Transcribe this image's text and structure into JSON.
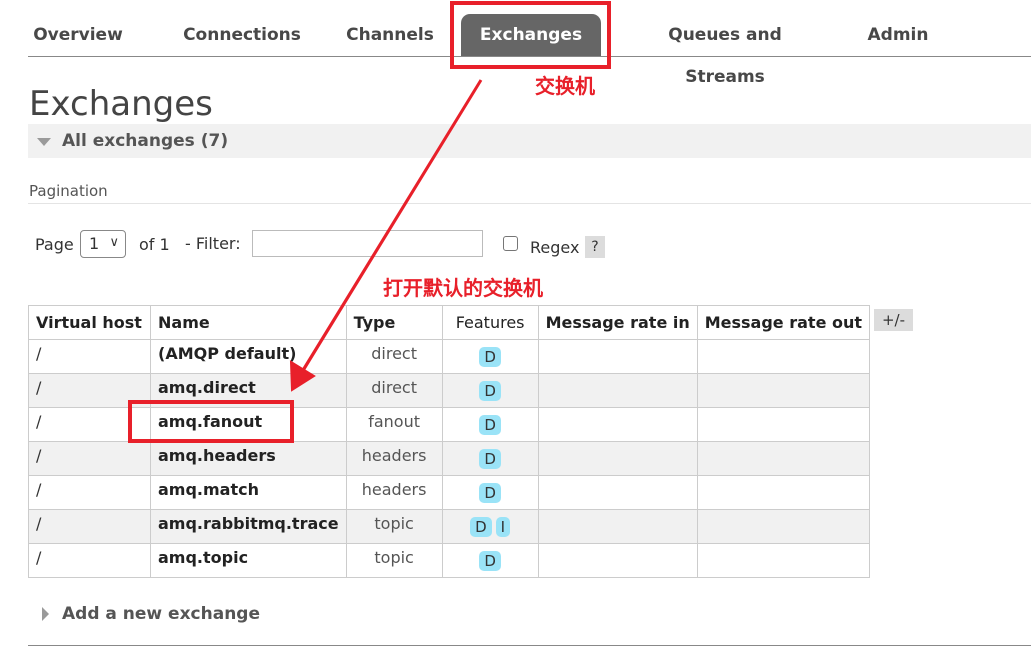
{
  "nav": {
    "tabs": [
      {
        "label": "Overview"
      },
      {
        "label": "Connections"
      },
      {
        "label": "Channels"
      },
      {
        "label": "Exchanges",
        "active": true
      },
      {
        "label": "Queues and Streams"
      },
      {
        "label": "Admin"
      }
    ]
  },
  "page": {
    "title": "Exchanges",
    "section_title": "All exchanges (7)"
  },
  "pagination": {
    "label": "Pagination",
    "page_label": "Page",
    "page_value": "1",
    "of_label": "of 1",
    "filter_label": "- Filter:",
    "filter_value": "",
    "regex_label": "Regex",
    "regex_checked": false,
    "help_label": "?"
  },
  "table": {
    "headers": [
      "Virtual host",
      "Name",
      "Type",
      "Features",
      "Message rate in",
      "Message rate out"
    ],
    "toggle_columns_label": "+/-",
    "rows": [
      {
        "vhost": "/",
        "name": "(AMQP default)",
        "type": "direct",
        "features": [
          "D"
        ],
        "rate_in": "",
        "rate_out": ""
      },
      {
        "vhost": "/",
        "name": "amq.direct",
        "type": "direct",
        "features": [
          "D"
        ],
        "rate_in": "",
        "rate_out": ""
      },
      {
        "vhost": "/",
        "name": "amq.fanout",
        "type": "fanout",
        "features": [
          "D"
        ],
        "rate_in": "",
        "rate_out": ""
      },
      {
        "vhost": "/",
        "name": "amq.headers",
        "type": "headers",
        "features": [
          "D"
        ],
        "rate_in": "",
        "rate_out": ""
      },
      {
        "vhost": "/",
        "name": "amq.match",
        "type": "headers",
        "features": [
          "D"
        ],
        "rate_in": "",
        "rate_out": ""
      },
      {
        "vhost": "/",
        "name": "amq.rabbitmq.trace",
        "type": "topic",
        "features": [
          "D",
          "I"
        ],
        "rate_in": "",
        "rate_out": ""
      },
      {
        "vhost": "/",
        "name": "amq.topic",
        "type": "topic",
        "features": [
          "D"
        ],
        "rate_in": "",
        "rate_out": ""
      }
    ]
  },
  "add_section": {
    "label": "Add a new exchange"
  },
  "annotations": {
    "tab_note": "交换机",
    "row_note": "打开默认的交换机",
    "color": "#e8202a"
  },
  "colors": {
    "active_tab_bg": "#666666",
    "feature_badge_bg": "#9ae3f7",
    "row_alt_bg": "#f1f1f1"
  }
}
